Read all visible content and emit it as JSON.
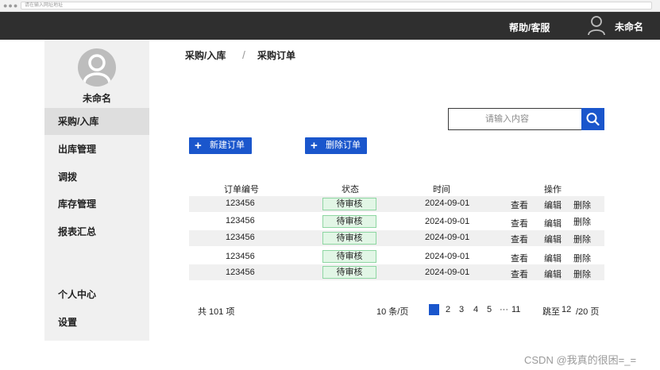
{
  "browser": {
    "address_placeholder": "请在输入网址地址"
  },
  "header": {
    "help": "帮助/客服",
    "user": "未命名"
  },
  "sidebar": {
    "user": "未命名",
    "items": [
      {
        "label": "采购/入库",
        "active": true
      },
      {
        "label": "出库管理"
      },
      {
        "label": "调拨"
      },
      {
        "label": "库存管理"
      },
      {
        "label": "报表汇总"
      },
      {
        "label": "个人中心"
      },
      {
        "label": "设置"
      }
    ]
  },
  "breadcrumb": {
    "level1": "采购/入库",
    "separator": "/",
    "level2": "采购订单"
  },
  "search": {
    "placeholder": "请输入内容",
    "icon": "search-icon"
  },
  "actions": {
    "new_order": "新建订单",
    "delete_order": "删除订单"
  },
  "table": {
    "columns": [
      "订单编号",
      "状态",
      "时间",
      "操作"
    ],
    "rows": [
      {
        "id": "123456",
        "status": "待审核",
        "time": "2024-09-01",
        "ops": [
          "查看",
          "编辑",
          "删除"
        ]
      },
      {
        "id": "123456",
        "status": "待审核",
        "time": "2024-09-01",
        "ops": [
          "查看",
          "编辑",
          "删除"
        ]
      },
      {
        "id": "123456",
        "status": "待审核",
        "time": "2024-09-01",
        "ops": [
          "查看",
          "编辑",
          "删除"
        ]
      },
      {
        "id": "123456",
        "status": "待审核",
        "time": "2024-09-01",
        "ops": [
          "查看",
          "编辑",
          "删除"
        ]
      },
      {
        "id": "123456",
        "status": "待审核",
        "time": "2024-09-01",
        "ops": [
          "查看",
          "编辑",
          "删除"
        ]
      }
    ]
  },
  "pagination": {
    "total": "共 101 项",
    "page_size": "10 条/页",
    "pages": [
      "1",
      "2",
      "3",
      "4",
      "5",
      "···",
      "11"
    ],
    "current_page": "1",
    "jump_label": "跳至",
    "jump_value": "12",
    "total_pages": "/20 页"
  },
  "watermark": "CSDN @我真的很困=_=",
  "colors": {
    "primary": "#1a56cc",
    "topbar": "#2f2f2f",
    "sidebar": "#f0f0f0",
    "status_bg": "#e2f6e6",
    "status_border": "#8ed6a2"
  }
}
